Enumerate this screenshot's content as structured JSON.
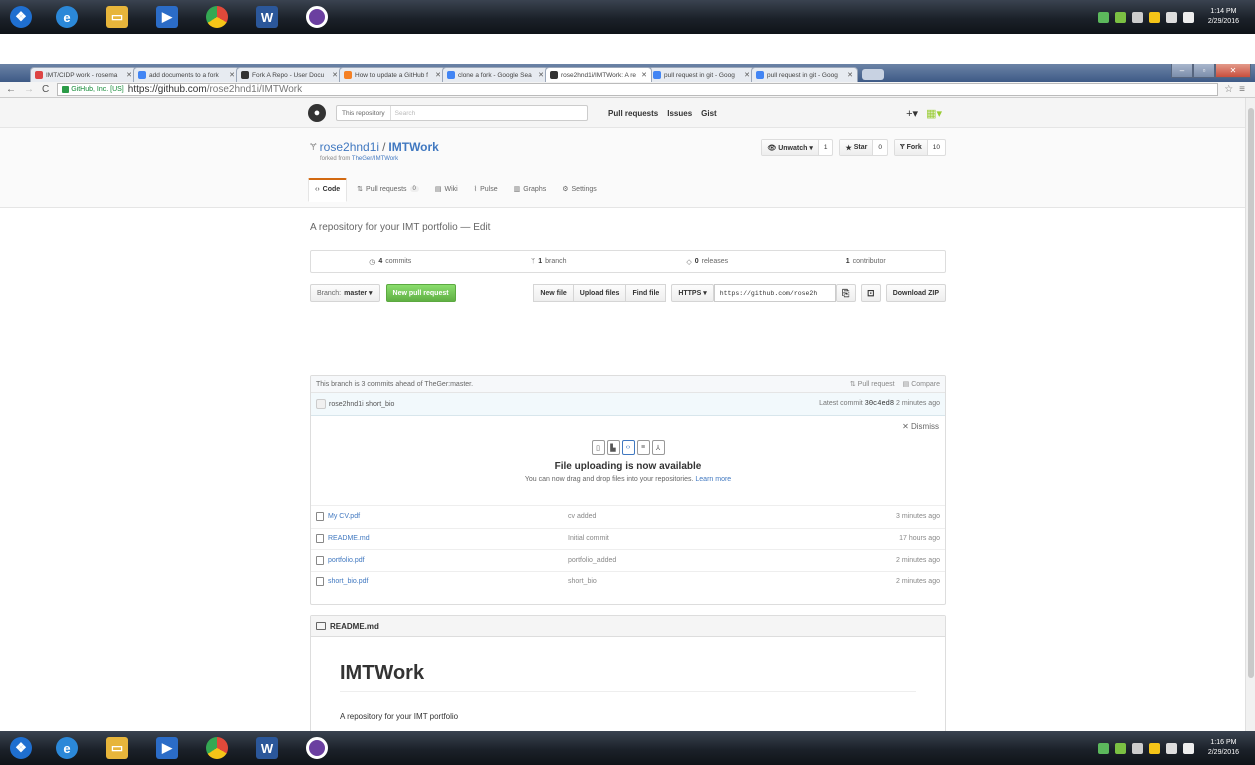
{
  "taskbar": {
    "apps": [
      {
        "icon": "windows-start-icon",
        "color": "#1f6fd0"
      },
      {
        "icon": "internet-explorer-icon",
        "color": "#2b88d8"
      },
      {
        "icon": "file-explorer-icon",
        "color": "#e7b53b"
      },
      {
        "icon": "media-player-icon",
        "color": "#2b6cc7"
      },
      {
        "icon": "chrome-icon",
        "color": "#e0493a"
      },
      {
        "icon": "word-icon",
        "color": "#2b579a",
        "glyph": "W"
      },
      {
        "icon": "app-icon",
        "color": "#6b3fa0"
      }
    ],
    "top_clock": {
      "time": "1:14 PM",
      "date": "2/29/2016"
    },
    "bottom_clock": {
      "time": "1:16 PM",
      "date": "2/29/2016"
    }
  },
  "browser": {
    "tabs": [
      {
        "title": "IMT/CIDP work - rosema",
        "favicon": "gmail-icon",
        "color": "#d44"
      },
      {
        "title": "add documents to a fork",
        "favicon": "google-icon",
        "color": "#4285f4"
      },
      {
        "title": "Fork A Repo - User Docu",
        "favicon": "github-icon",
        "color": "#333"
      },
      {
        "title": "How to update a GitHub f",
        "favicon": "stackoverflow-icon",
        "color": "#f48024"
      },
      {
        "title": "clone a fork - Google Sea",
        "favicon": "google-icon",
        "color": "#4285f4"
      },
      {
        "title": "rose2hnd1i/IMTWork: A re",
        "favicon": "github-icon",
        "color": "#333",
        "active": true
      },
      {
        "title": "pull request in git - Goog",
        "favicon": "google-icon",
        "color": "#4285f4"
      },
      {
        "title": "pull request in git - Goog",
        "favicon": "google-icon",
        "color": "#4285f4"
      }
    ],
    "secure_label": "GitHub, Inc. [US]",
    "url_host": "https://github.com",
    "url_path": "/rose2hnd1i/IMTWork"
  },
  "gh": {
    "search_scope": "This repository",
    "search_placeholder": "Search",
    "nav": [
      "Pull requests",
      "Issues",
      "Gist"
    ],
    "plus": "+▾",
    "owner": "rose2hnd1i",
    "repo": "IMTWork",
    "forked_prefix": "forked from",
    "forked_from": "TheGer/IMTWork",
    "watch_label": "Unwatch ▾",
    "watch_count": "1",
    "star_label": "Star",
    "star_count": "0",
    "fork_label": "Fork",
    "fork_count": "10",
    "tabs": [
      {
        "label": "Code",
        "icon": "code-icon",
        "selected": true
      },
      {
        "label": "Pull requests",
        "icon": "pull-request-icon",
        "count": "0"
      },
      {
        "label": "Wiki",
        "icon": "book-icon"
      },
      {
        "label": "Pulse",
        "icon": "pulse-icon"
      },
      {
        "label": "Graphs",
        "icon": "graph-icon"
      },
      {
        "label": "Settings",
        "icon": "gear-icon"
      }
    ],
    "description": "A repository for your IMT portfolio — Edit",
    "summary": {
      "commits_num": "4",
      "commits_label": "commits",
      "branch_num": "1",
      "branch_label": "branch",
      "releases_num": "0",
      "releases_label": "releases",
      "contrib_num": "1",
      "contrib_label": "contributor"
    },
    "branch_label": "Branch:",
    "branch_name": "master ▾",
    "new_pr": "New pull request",
    "new_file": "New file",
    "upload_files": "Upload files",
    "find_file": "Find file",
    "protocol": "HTTPS ▾",
    "clone_url": "https://github.com/rose2h",
    "download_zip": "Download ZIP",
    "ahead_text": "This branch is 3 commits ahead of TheGer:master.",
    "pull_request_link": "Pull request",
    "compare_link": "Compare",
    "commit_author": "rose2hnd1i",
    "commit_message": "short_bio",
    "latest_commit_label": "Latest commit",
    "commit_sha": "30c4ed8",
    "commit_age": "2 minutes ago",
    "dismiss": "✕ Dismiss",
    "upload_title": "File uploading is now available",
    "upload_text": "You can now drag and drop files into your repositories.",
    "learn_more": "Learn more",
    "files": [
      {
        "name": "My CV.pdf",
        "message": "cv added",
        "age": "3 minutes ago"
      },
      {
        "name": "README.md",
        "message": "Initial commit",
        "age": "17 hours ago"
      },
      {
        "name": "portfolio.pdf",
        "message": "portfolio_added",
        "age": "2 minutes ago"
      },
      {
        "name": "short_bio.pdf",
        "message": "short_bio",
        "age": "2 minutes ago"
      }
    ],
    "readme_header": "README.md",
    "readme_title": "IMTWork",
    "readme_text": "A repository for your IMT portfolio"
  }
}
